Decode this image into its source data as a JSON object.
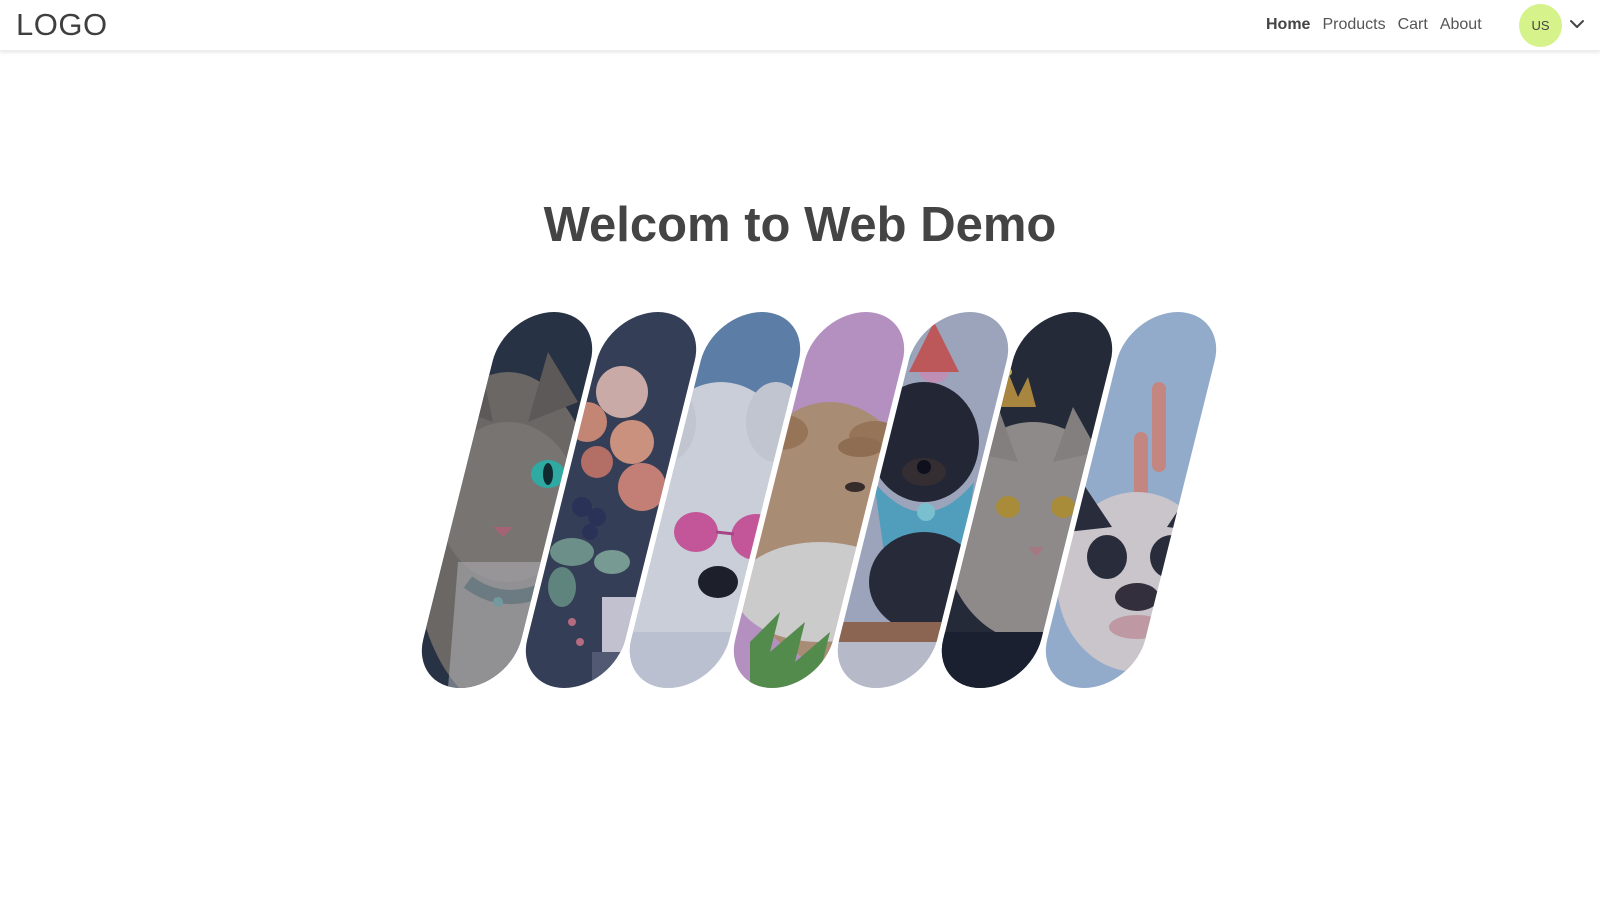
{
  "header": {
    "logo": "LOGO",
    "nav": [
      {
        "label": "Home",
        "active": true
      },
      {
        "label": "Products",
        "active": false
      },
      {
        "label": "Cart",
        "active": false
      },
      {
        "label": "About",
        "active": false
      }
    ],
    "avatar_initials": "US",
    "avatar_color": "#d6f28a",
    "menu_icon": "chevron-down-icon"
  },
  "hero": {
    "title": "Welcom to Web Demo"
  },
  "gallery": {
    "items": [
      {
        "subject": "tabby cat with green eyes and collar",
        "bg": "#2a3440",
        "fg": "#8b8378"
      },
      {
        "subject": "flower bouquet",
        "bg": "#3a4256",
        "fg": "#e8a58c"
      },
      {
        "subject": "white dog wearing pink heart sunglasses",
        "bg": "#6b8fb8",
        "fg": "#eef0f2"
      },
      {
        "subject": "dog wearing party hat",
        "bg": "#d6a6d8",
        "fg": "#c9a27a"
      },
      {
        "subject": "small black dog with party hat and bandana",
        "bg": "#b9bfd1",
        "fg": "#2c2c34"
      },
      {
        "subject": "grey cat wearing gold crown",
        "bg": "#262a30",
        "fg": "#a89f94"
      },
      {
        "subject": "french bulldog puppy with finger bunny ears",
        "bg": "#aec7e4",
        "fg": "#f1e7e4"
      }
    ]
  }
}
